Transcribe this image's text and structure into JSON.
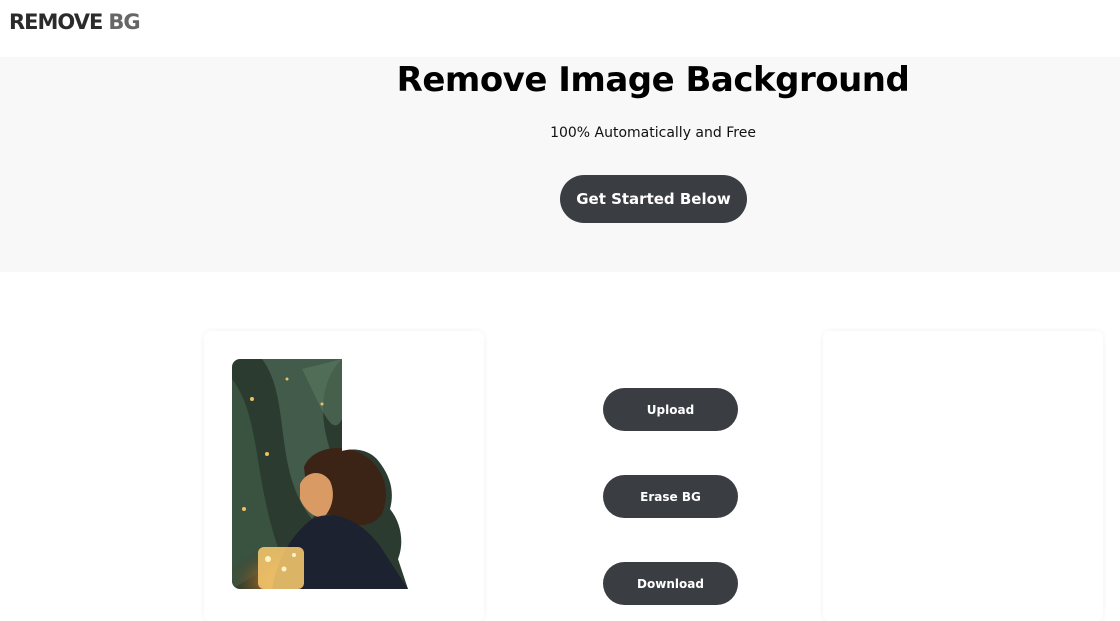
{
  "header": {
    "logo_main": "REMOVE",
    "logo_accent": "BG"
  },
  "hero": {
    "title": "Remove Image Background",
    "subtitle": "100% Automatically and Free",
    "cta_label": "Get Started Below"
  },
  "actions": {
    "upload_label": "Upload",
    "erase_label": "Erase BG",
    "download_label": "Download"
  },
  "colors": {
    "button_bg": "#3a3d42",
    "hero_bg": "#f8f8f8"
  }
}
